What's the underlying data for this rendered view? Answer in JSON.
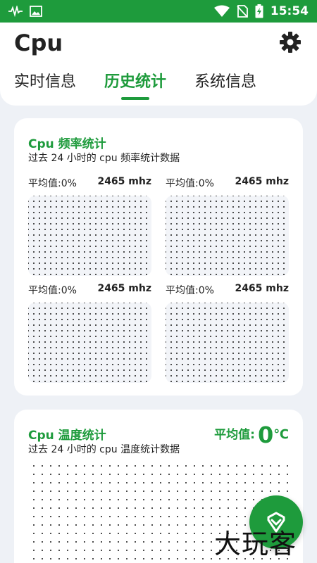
{
  "status_bar": {
    "time": "15:54",
    "icons": [
      "pulse-icon",
      "image-icon",
      "wifi-icon",
      "no-sim-icon",
      "battery-charging-icon"
    ]
  },
  "header": {
    "title": "Cpu",
    "settings_icon": "gear-icon",
    "tabs": [
      {
        "label": "实时信息",
        "active": false
      },
      {
        "label": "历史统计",
        "active": true
      },
      {
        "label": "系统信息",
        "active": false
      }
    ]
  },
  "freq_card": {
    "title": "Cpu 频率统计",
    "subtitle": "过去 24 小时的 cpu 频率统计数据",
    "charts": [
      {
        "avg_label": "平均值:0%",
        "freq": "2465 mhz"
      },
      {
        "avg_label": "平均值:0%",
        "freq": "2465 mhz"
      },
      {
        "avg_label": "平均值:0%",
        "freq": "2465 mhz"
      },
      {
        "avg_label": "平均值:0%",
        "freq": "2465 mhz"
      }
    ]
  },
  "temp_card": {
    "title": "Cpu 温度统计",
    "subtitle": "过去 24 小时的 cpu 温度统计数据",
    "avg_label": "平均值:",
    "avg_value": "0",
    "avg_unit": "℃"
  },
  "fab": {
    "icon": "chevron-down-icon"
  },
  "watermark": "大玩客",
  "colors": {
    "accent": "#1e9b3c",
    "background": "#eef1f6",
    "card": "#ffffff"
  }
}
